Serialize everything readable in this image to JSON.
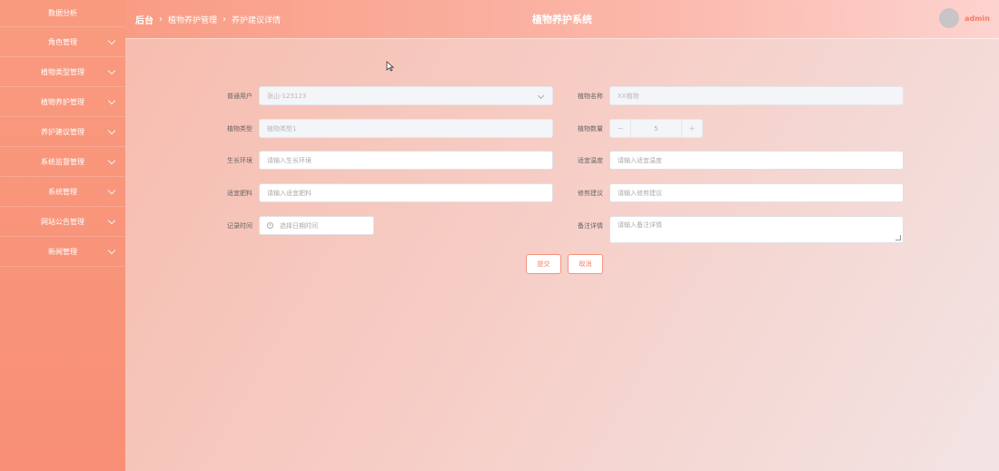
{
  "sidebar": {
    "items": [
      {
        "label": "数据分析"
      },
      {
        "label": "角色管理"
      },
      {
        "label": "植物类型管理"
      },
      {
        "label": "植物养护管理"
      },
      {
        "label": "养护建议管理"
      },
      {
        "label": "系统监督管理"
      },
      {
        "label": "系统管理"
      },
      {
        "label": "网站公告管理"
      },
      {
        "label": "新闻管理"
      }
    ]
  },
  "header": {
    "breadcrumb": {
      "home": "后台",
      "level1": "植物养护管理",
      "level2": "养护建议详情"
    },
    "title": "植物养护系统",
    "username": "admin"
  },
  "form": {
    "user": {
      "label": "普通用户",
      "value": "张山-123123"
    },
    "plant_name": {
      "label": "植物名称",
      "value": "XX植物"
    },
    "plant_type": {
      "label": "植物类型",
      "value": "植物类型1"
    },
    "plant_count": {
      "label": "植物数量",
      "value": "5",
      "minus": "−",
      "plus": "+"
    },
    "environment": {
      "label": "生长环境",
      "placeholder": "请输入生长环境"
    },
    "temperature": {
      "label": "适宜温度",
      "placeholder": "请输入适宜温度"
    },
    "fertilizer": {
      "label": "适宜肥料",
      "placeholder": "请输入适宜肥料"
    },
    "pruning": {
      "label": "修剪建议",
      "placeholder": "请输入修剪建议"
    },
    "record_time": {
      "label": "记录时间",
      "placeholder": "选择日期时间"
    },
    "notes": {
      "label": "备注详情",
      "placeholder": "请输入备注详情"
    }
  },
  "buttons": {
    "submit": "提交",
    "cancel": "取消"
  },
  "colors": {
    "sidebar": "#f99a7f",
    "accent": "#f4826a"
  }
}
